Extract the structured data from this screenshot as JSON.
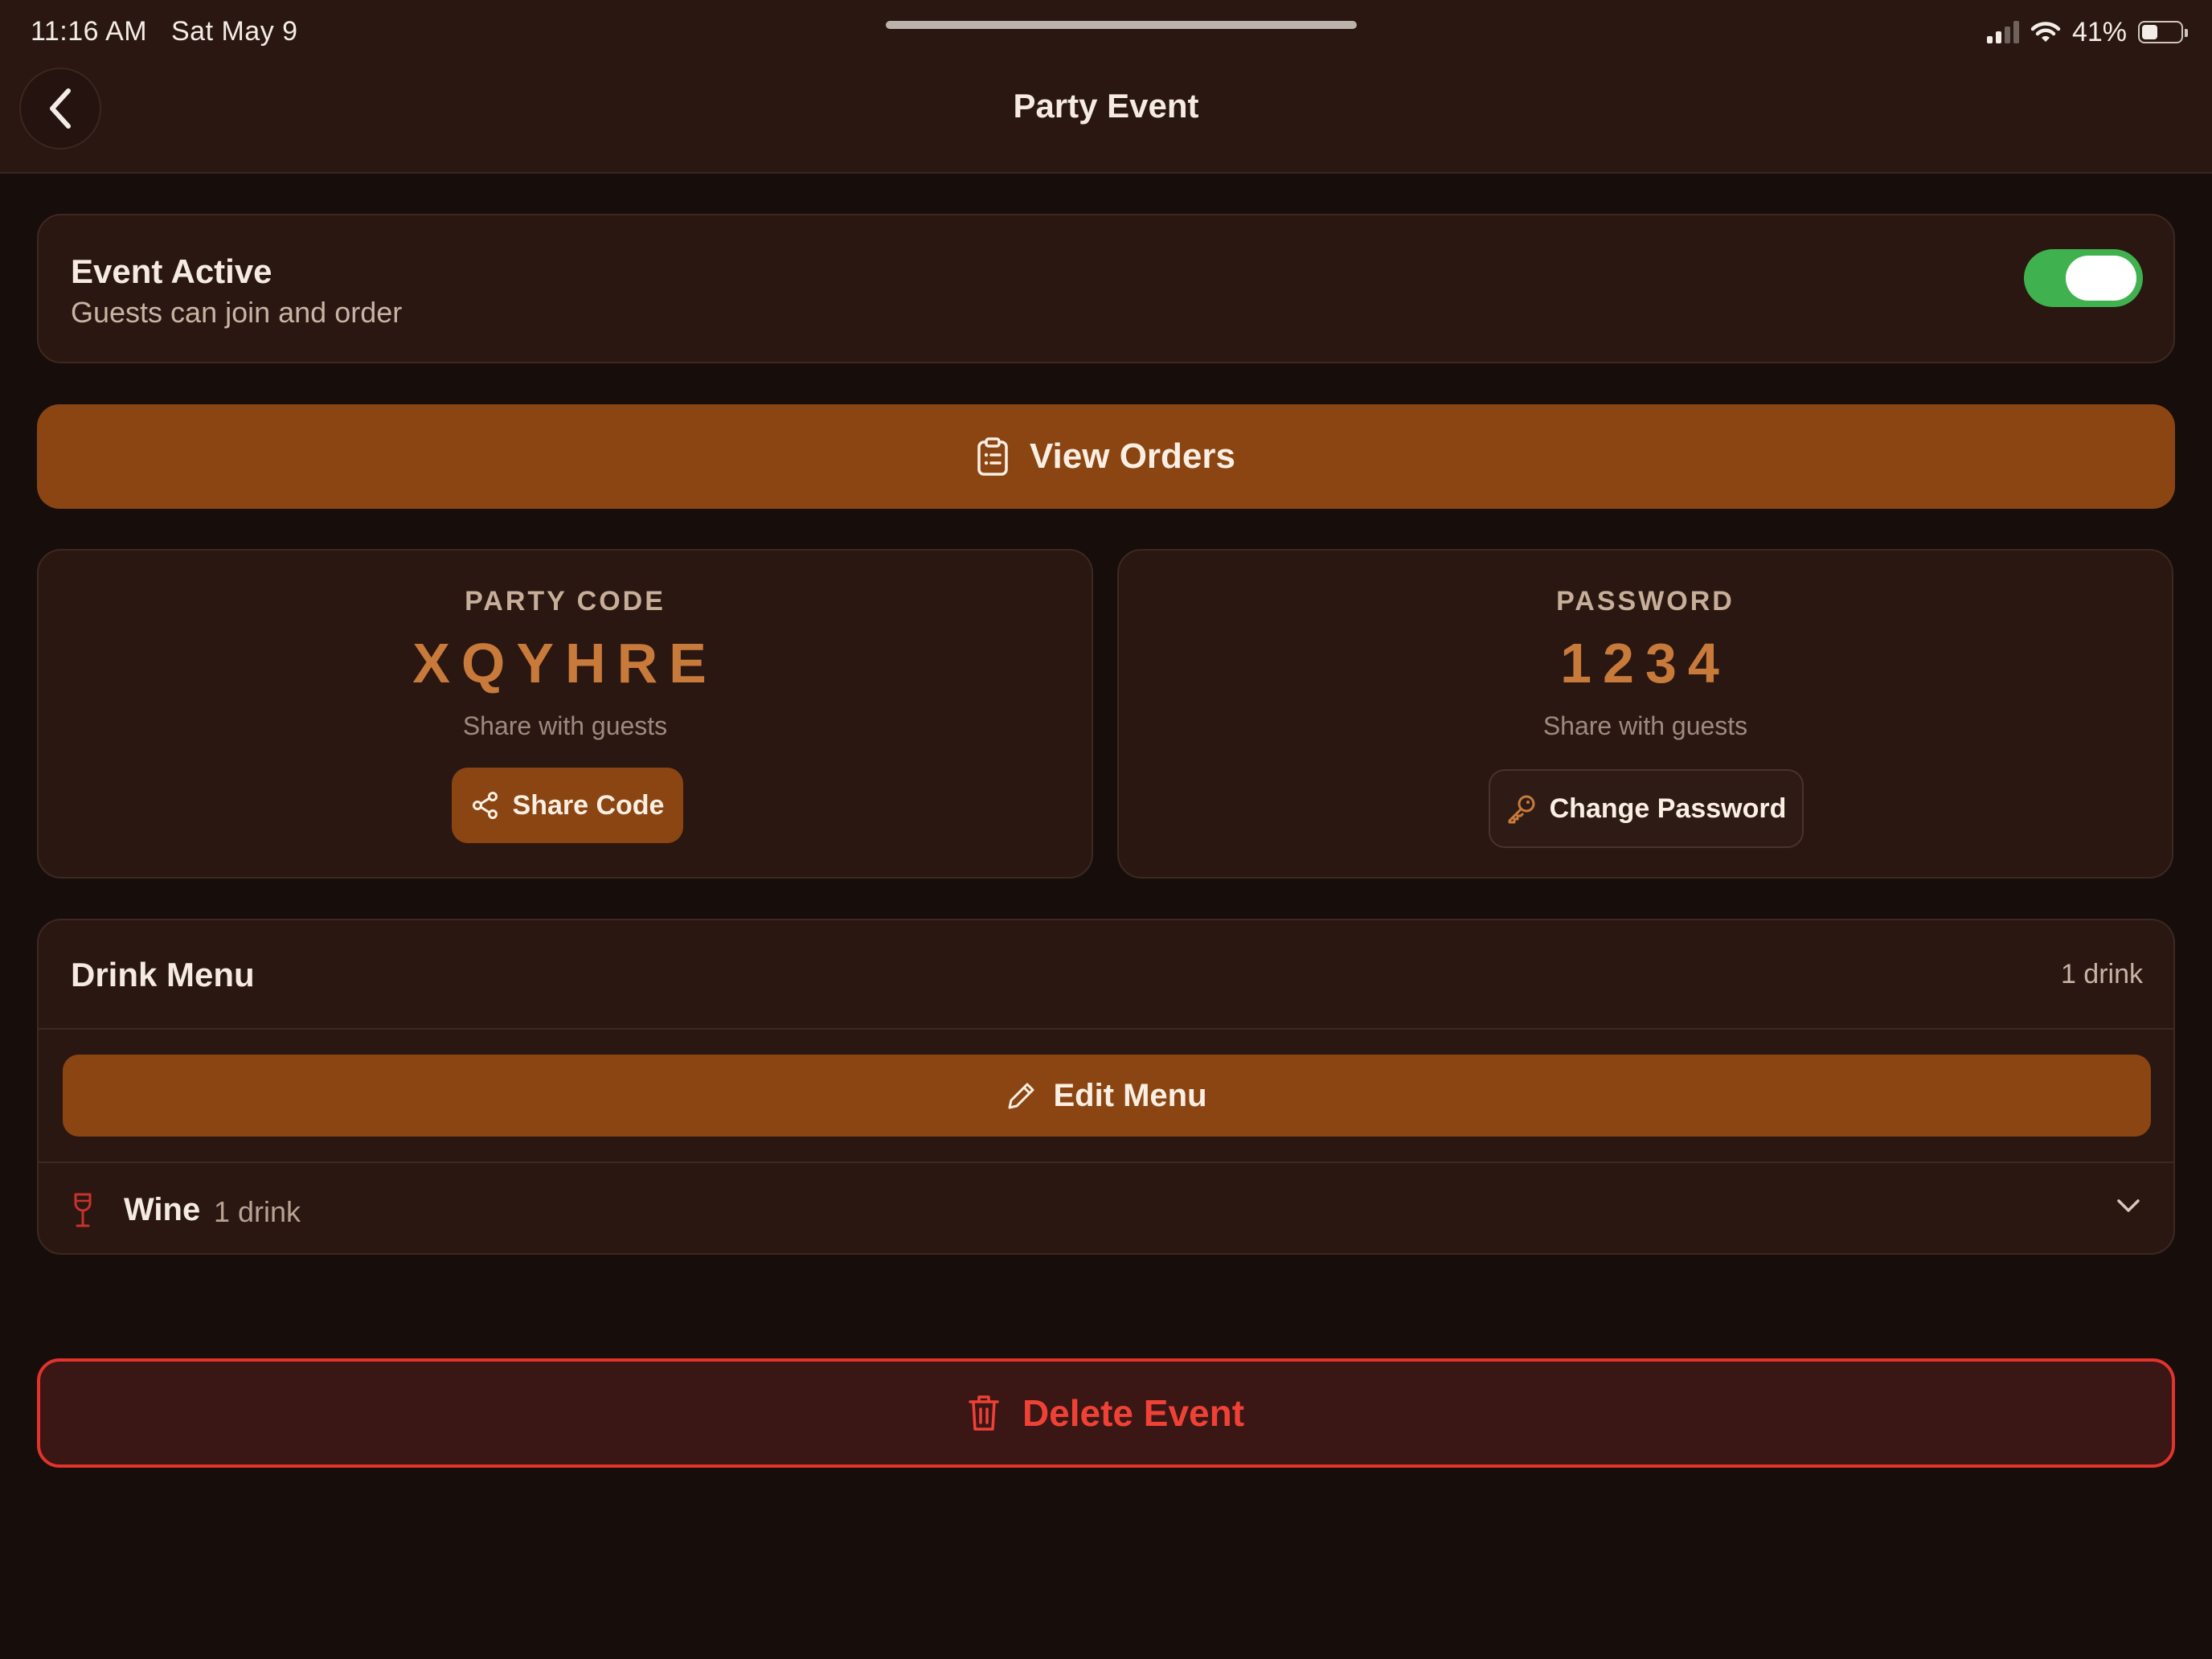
{
  "status_bar": {
    "time": "11:16 AM",
    "date": "Sat May 9",
    "battery": "41%",
    "battery_level": 0.41
  },
  "nav": {
    "title": "Party Event",
    "back_icon": "chevron-left-icon"
  },
  "event_active": {
    "title": "Event Active",
    "subtitle": "Guests can join and order",
    "toggle_on": true
  },
  "view_orders": {
    "label": "View Orders",
    "icon": "clipboard-icon"
  },
  "party_code": {
    "label": "PARTY CODE",
    "value": "XQYHRE",
    "hint": "Share with guests",
    "button_label": "Share Code",
    "button_icon": "share-icon"
  },
  "password": {
    "label": "PASSWORD",
    "value": "1234",
    "hint": "Share with guests",
    "button_label": "Change Password",
    "button_icon": "key-icon"
  },
  "drink_menu": {
    "title": "Drink Menu",
    "count": "1 drink",
    "edit_label": "Edit Menu",
    "edit_icon": "pencil-icon",
    "categories": [
      {
        "name": "Wine",
        "count": "1 drink",
        "icon": "wine-glass-icon"
      }
    ]
  },
  "delete_event": {
    "label": "Delete Event",
    "icon": "trash-icon"
  },
  "colors": {
    "background": "#170e0b",
    "card": "#2a1712",
    "accent": "#8b4513",
    "code_text": "#c87a3a",
    "toggle_on": "#3fb24f",
    "danger": "#e2332d"
  }
}
